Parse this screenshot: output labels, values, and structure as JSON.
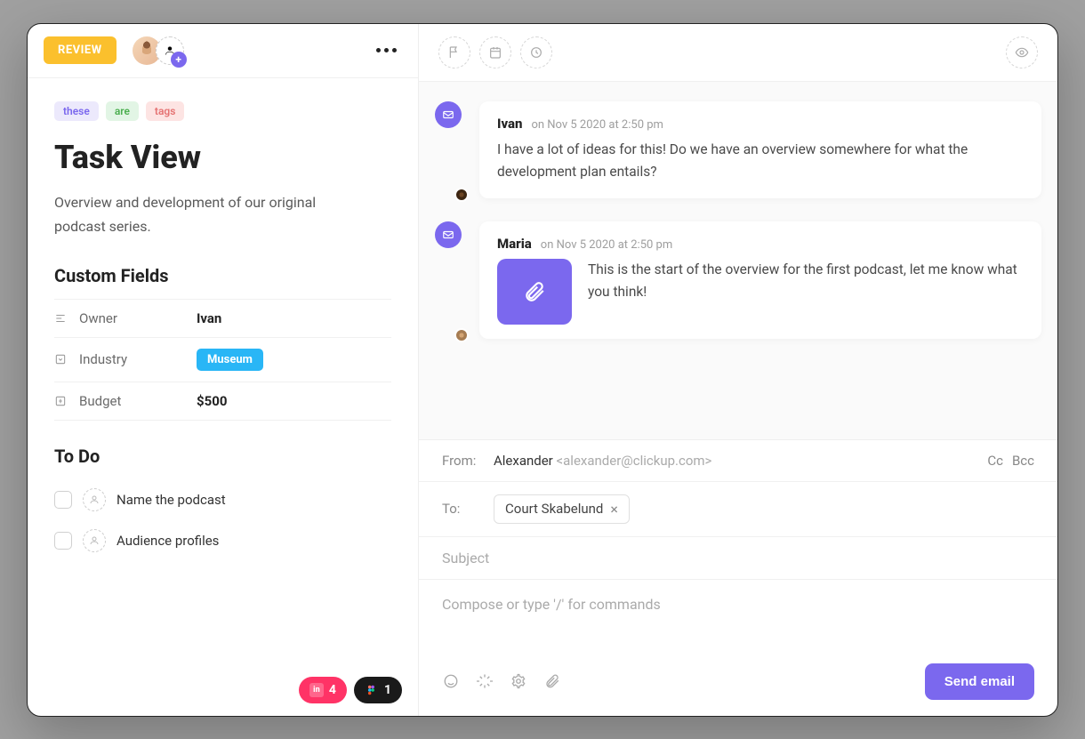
{
  "header": {
    "status_label": "REVIEW"
  },
  "tags": [
    {
      "label": "these",
      "cls": "purple"
    },
    {
      "label": "are",
      "cls": "green"
    },
    {
      "label": "tags",
      "cls": "red"
    }
  ],
  "task": {
    "title": "Task View",
    "description": "Overview and development of our original podcast series."
  },
  "custom_fields": {
    "heading": "Custom Fields",
    "items": [
      {
        "label": "Owner",
        "value": "Ivan",
        "type": "text"
      },
      {
        "label": "Industry",
        "value": "Museum",
        "type": "chip"
      },
      {
        "label": "Budget",
        "value": "$500",
        "type": "text"
      }
    ]
  },
  "todo": {
    "heading": "To Do",
    "items": [
      {
        "text": "Name the podcast"
      },
      {
        "text": "Audience profiles"
      }
    ]
  },
  "footer_pills": {
    "invision_count": "4",
    "figma_count": "1"
  },
  "comments": [
    {
      "author": "Ivan",
      "timestamp": "on Nov 5 2020 at 2:50 pm",
      "body": "I have a lot of ideas for this! Do we have an overview somewhere for what the development plan entails?",
      "has_attachment": false
    },
    {
      "author": "Maria",
      "timestamp": "on Nov 5 2020 at 2:50 pm",
      "body": "This is the start of the overview for the first podcast, let me know what you think!",
      "has_attachment": true
    }
  ],
  "composer": {
    "from_label": "From:",
    "from_name": "Alexander",
    "from_email": "<alexander@clickup.com>",
    "cc_label": "Cc",
    "bcc_label": "Bcc",
    "to_label": "To:",
    "to_chip": "Court Skabelund",
    "subject_placeholder": "Subject",
    "body_placeholder": "Compose or type '/' for commands",
    "send_label": "Send email"
  }
}
